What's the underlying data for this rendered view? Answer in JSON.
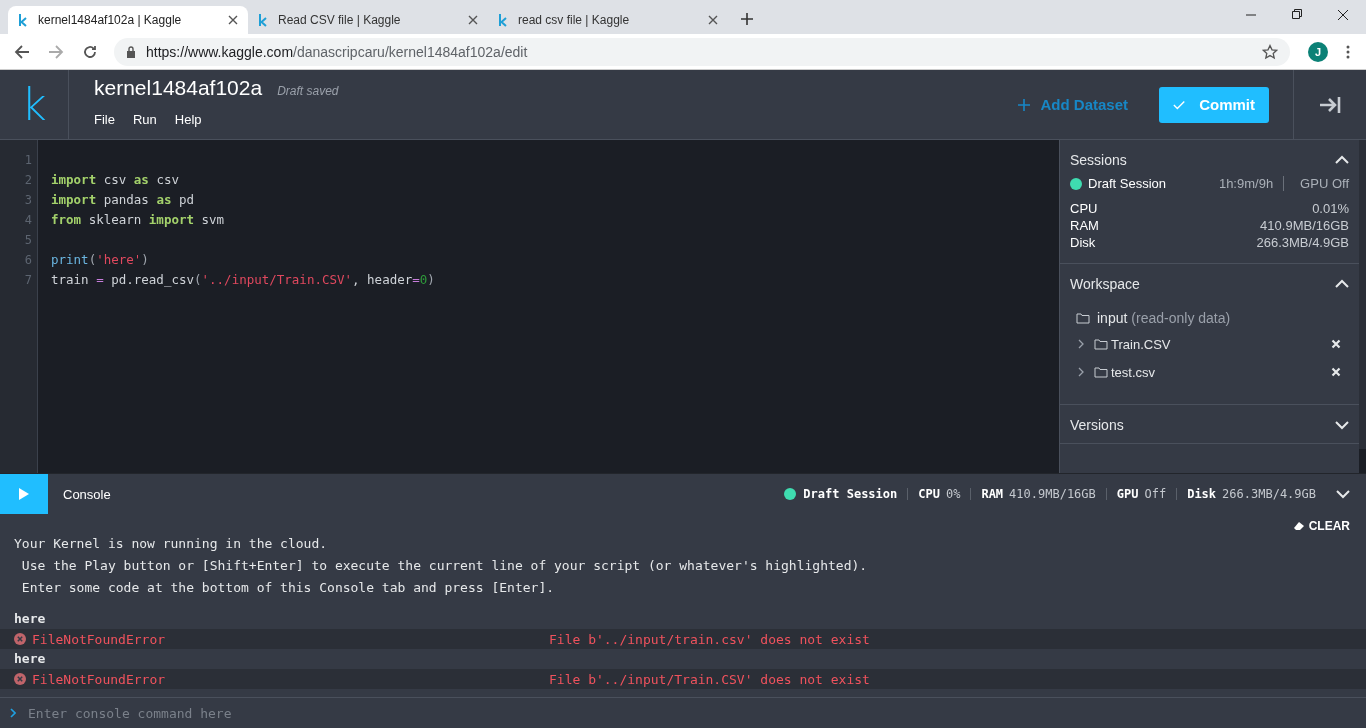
{
  "browser": {
    "tabs": [
      {
        "title": "kernel1484af102a | Kaggle",
        "selected": true
      },
      {
        "title": "Read CSV file | Kaggle",
        "selected": false
      },
      {
        "title": "read csv file | Kaggle",
        "selected": false
      }
    ],
    "url_host": "https://www.kaggle.com",
    "url_path": "/danascripcaru/kernel1484af102a/edit",
    "profile_initial": "J"
  },
  "header": {
    "logo": "k",
    "title": "kernel1484af102a",
    "save_status": "Draft saved",
    "menu": [
      "File",
      "Run",
      "Help"
    ],
    "add_dataset": "Add Dataset",
    "commit": "Commit"
  },
  "editor": {
    "lines": [
      {
        "number": "1"
      },
      {
        "number": "2",
        "tokens": [
          {
            "kind": "keyword",
            "text": "import"
          },
          {
            "kind": "plain",
            "text": " csv "
          },
          {
            "kind": "keyword",
            "text": "as"
          },
          {
            "kind": "plain",
            "text": " csv"
          }
        ]
      },
      {
        "number": "3",
        "tokens": [
          {
            "kind": "keyword",
            "text": "import"
          },
          {
            "kind": "plain",
            "text": " pandas "
          },
          {
            "kind": "keyword",
            "text": "as"
          },
          {
            "kind": "plain",
            "text": " pd"
          }
        ]
      },
      {
        "number": "4",
        "tokens": [
          {
            "kind": "keyword",
            "text": "from"
          },
          {
            "kind": "plain",
            "text": " sklearn "
          },
          {
            "kind": "keyword",
            "text": "import"
          },
          {
            "kind": "plain",
            "text": " svm"
          }
        ]
      },
      {
        "number": "5"
      },
      {
        "number": "6",
        "tokens": [
          {
            "kind": "builtin",
            "text": "print"
          },
          {
            "kind": "punct",
            "text": "("
          },
          {
            "kind": "string",
            "text": "'here'"
          },
          {
            "kind": "punct",
            "text": ")"
          }
        ]
      },
      {
        "number": "7",
        "tokens": [
          {
            "kind": "plain",
            "text": "train "
          },
          {
            "kind": "operator",
            "text": "="
          },
          {
            "kind": "plain",
            "text": " pd.read_csv"
          },
          {
            "kind": "punct",
            "text": "("
          },
          {
            "kind": "string",
            "text": "'../input/Train.CSV'"
          },
          {
            "kind": "plain",
            "text": ", header"
          },
          {
            "kind": "operator",
            "text": "="
          },
          {
            "kind": "number",
            "text": "0"
          },
          {
            "kind": "punct",
            "text": ")"
          }
        ]
      }
    ]
  },
  "sidebar": {
    "sections": [
      {
        "kind": "sessions",
        "title": "Sessions",
        "expanded": true,
        "session": "Draft Session",
        "time": "1h:9m/9h",
        "gpu": "GPU Off",
        "stats": [
          {
            "label": "CPU",
            "value": "0.01%"
          },
          {
            "label": "RAM",
            "value": "410.9MB/16GB"
          },
          {
            "label": "Disk",
            "value": "266.3MB/4.9GB"
          }
        ]
      },
      {
        "kind": "workspace",
        "title": "Workspace",
        "expanded": true,
        "folder": "input",
        "folder_note": "(read-only data)",
        "files": [
          {
            "name": "Train.CSV",
            "expanded": false
          },
          {
            "name": "test.csv",
            "expanded": false
          }
        ]
      },
      {
        "title": "Versions",
        "expanded": false
      }
    ]
  },
  "console": {
    "title": "Console",
    "session": "Draft Session",
    "stats": [
      {
        "label": "CPU",
        "value": "0%"
      },
      {
        "label": "RAM",
        "value": "410.9MB/16GB"
      },
      {
        "label": "GPU",
        "value": "Off"
      },
      {
        "label": "Disk",
        "value": "266.3MB/4.9GB"
      }
    ],
    "clear": "CLEAR",
    "intro": [
      "Your Kernel is now running in the cloud.",
      " Use the Play button or [Shift+Enter] to execute the current line of your script (or whatever's highlighted).",
      " Enter some code at the bottom of this Console tab and press [Enter]."
    ],
    "messages": [
      {
        "kind": "output",
        "text": "here"
      },
      {
        "kind": "error",
        "name": "FileNotFoundError",
        "detail": "File b'../input/train.csv' does not exist"
      },
      {
        "kind": "output",
        "text": "here"
      },
      {
        "kind": "error",
        "name": "FileNotFoundError",
        "detail": "File b'../input/Train.CSV' does not exist"
      }
    ],
    "placeholder": "Enter console command here"
  }
}
